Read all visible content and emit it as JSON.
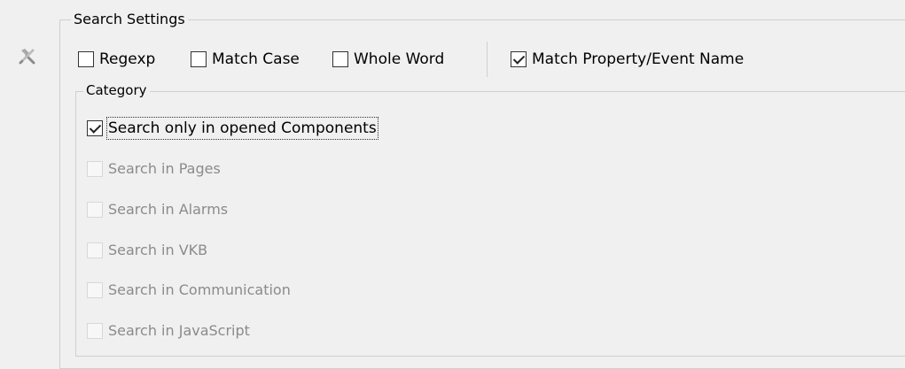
{
  "settings": {
    "group_title": "Search Settings",
    "regexp_label": "Regexp",
    "regexp_checked": false,
    "match_case_label": "Match Case",
    "match_case_checked": false,
    "whole_word_label": "Whole Word",
    "whole_word_checked": false,
    "match_property_label": "Match Property/Event Name",
    "match_property_checked": true
  },
  "category": {
    "group_title": "Category",
    "items": [
      {
        "label": "Search only in opened Components",
        "checked": true,
        "enabled": true
      },
      {
        "label": "Search in Pages",
        "checked": false,
        "enabled": false
      },
      {
        "label": "Search in Alarms",
        "checked": false,
        "enabled": false
      },
      {
        "label": "Search in VKB",
        "checked": false,
        "enabled": false
      },
      {
        "label": "Search in Communication",
        "checked": false,
        "enabled": false
      },
      {
        "label": "Search in JavaScript",
        "checked": false,
        "enabled": false
      }
    ]
  },
  "icons": {
    "tool": "tools-icon"
  },
  "colors": {
    "background": "#f0f0f0",
    "group_border": "#cfcfcf",
    "disabled_text": "#8b8b8b"
  }
}
